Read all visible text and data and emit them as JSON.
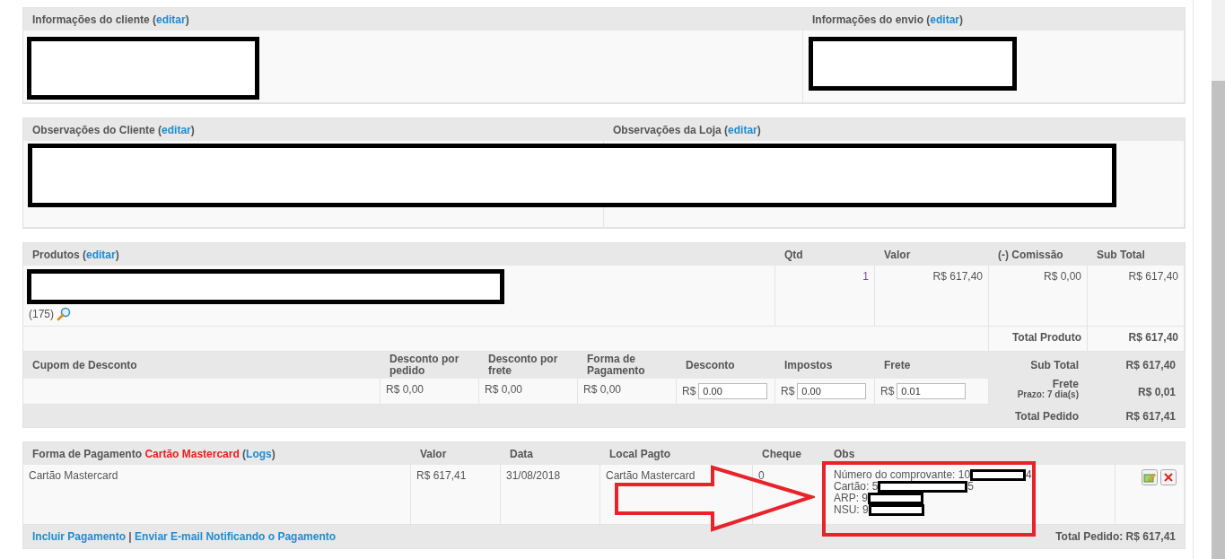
{
  "client_info": {
    "title": [
      {
        "text": "Informações do cliente (",
        "kind": "plain"
      },
      {
        "text": "editar",
        "kind": "link"
      },
      {
        "text": ")",
        "kind": "plain"
      }
    ]
  },
  "shipping_info": {
    "title": [
      {
        "text": "Informações do envio (",
        "kind": "plain"
      },
      {
        "text": "editar",
        "kind": "link"
      },
      {
        "text": ")",
        "kind": "plain"
      }
    ]
  },
  "customer_notes": {
    "title": [
      {
        "text": "Observações do Cliente (",
        "kind": "plain"
      },
      {
        "text": "editar",
        "kind": "link"
      },
      {
        "text": ")",
        "kind": "plain"
      }
    ]
  },
  "store_notes": {
    "title": [
      {
        "text": "Observações da Loja (",
        "kind": "plain"
      },
      {
        "text": "editar",
        "kind": "link"
      },
      {
        "text": ")",
        "kind": "plain"
      }
    ]
  },
  "products": {
    "title": [
      {
        "text": "Produtos (",
        "kind": "plain"
      },
      {
        "text": "editar",
        "kind": "link"
      },
      {
        "text": ")",
        "kind": "plain"
      }
    ],
    "columns": [
      "Qtd",
      "Valor",
      "(-) Comissão",
      "Sub Total"
    ],
    "rows": [
      {
        "code": "(175)",
        "qty": "1",
        "valor": "R$ 617,40",
        "comissao": "R$ 0,00",
        "subtotal": "R$ 617,40"
      }
    ],
    "total_produto": {
      "label": "Total Produto",
      "value": "R$ 617,40"
    }
  },
  "discounts": {
    "columns": [
      "Cupom de Desconto",
      "Desconto por pedido",
      "Desconto por frete",
      "Forma de Pagamento",
      "Desconto",
      "Impostos",
      "Frete"
    ],
    "values": [
      "R$ 0,00",
      "R$ 0,00",
      "R$ 0,00"
    ],
    "inputs": [
      {
        "currency": "R$",
        "value": "0.00"
      },
      {
        "currency": "R$",
        "value": "0.00"
      },
      {
        "currency": "R$",
        "value": "0.01"
      }
    ]
  },
  "totals": [
    {
      "label": "Sub Total",
      "value": "R$ 617,40"
    },
    {
      "label": "Frete",
      "note": "Prazo: 7 dia(s)",
      "value": "R$ 0,01"
    },
    {
      "label": "Total Pedido",
      "value": "R$ 617,41"
    }
  ],
  "payments": {
    "title": [
      {
        "text": "Forma de Pagamento ",
        "kind": "plain"
      },
      {
        "text": "Cartão Mastercard",
        "kind": "highlight"
      },
      {
        "text": " (",
        "kind": "plain"
      },
      {
        "text": "Logs",
        "kind": "link"
      },
      {
        "text": ")",
        "kind": "plain"
      }
    ],
    "columns": [
      "Valor",
      "Data",
      "Local Pagto",
      "Cheque",
      "Obs"
    ],
    "rows": [
      {
        "method": "Cartão Mastercard",
        "valor": "R$ 617,41",
        "data": "31/08/2018",
        "local": "Cartão Mastercard",
        "cheque": "0",
        "obs": [
          {
            "before": "Número do comprovante: 10",
            "after": "4"
          },
          {
            "before": "Cartão: 5",
            "after": "5"
          },
          {
            "before": "ARP: 9"
          },
          {
            "before": "NSU: 9"
          }
        ]
      }
    ],
    "links": [
      {
        "text": "Incluir Pagamento",
        "kind": "link"
      },
      {
        "text": " | ",
        "kind": "plain"
      },
      {
        "text": "Enviar E-mail Notificando o Pagamento",
        "kind": "link"
      }
    ],
    "total": "Total Pedido: R$ 617,41"
  }
}
